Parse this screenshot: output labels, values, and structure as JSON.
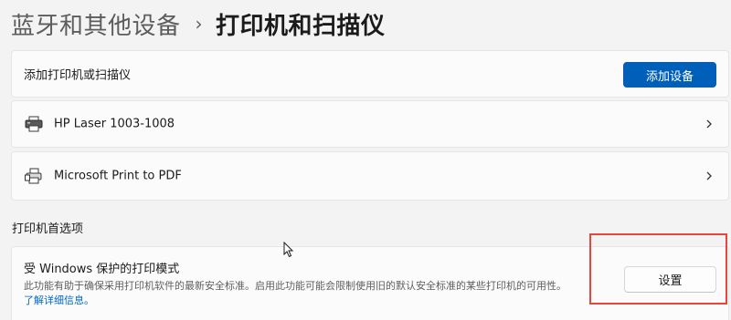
{
  "breadcrumb": {
    "parent": "蓝牙和其他设备",
    "separator": "›",
    "current": "打印机和扫描仪"
  },
  "add_device": {
    "label": "添加打印机或扫描仪",
    "button_label": "添加设备"
  },
  "printers": [
    {
      "name": "HP Laser 1003-1008",
      "icon": "printer-icon"
    },
    {
      "name": "Microsoft Print to PDF",
      "icon": "printer-pdf-icon"
    }
  ],
  "preferences": {
    "section_title": "打印机首选项",
    "protected_mode": {
      "title": "受 Windows 保护的打印模式",
      "description": "此功能有助于确保采用打印机软件的最新安全标准。启用此功能可能会限制使用旧的默认安全标准的某些打印机的可用性。",
      "link": "了解详细信息。",
      "button_label": "设置"
    }
  },
  "colors": {
    "accent": "#005fb8",
    "link": "#0067c0",
    "highlight": "#e8453c",
    "background": "#f3f3f3"
  }
}
